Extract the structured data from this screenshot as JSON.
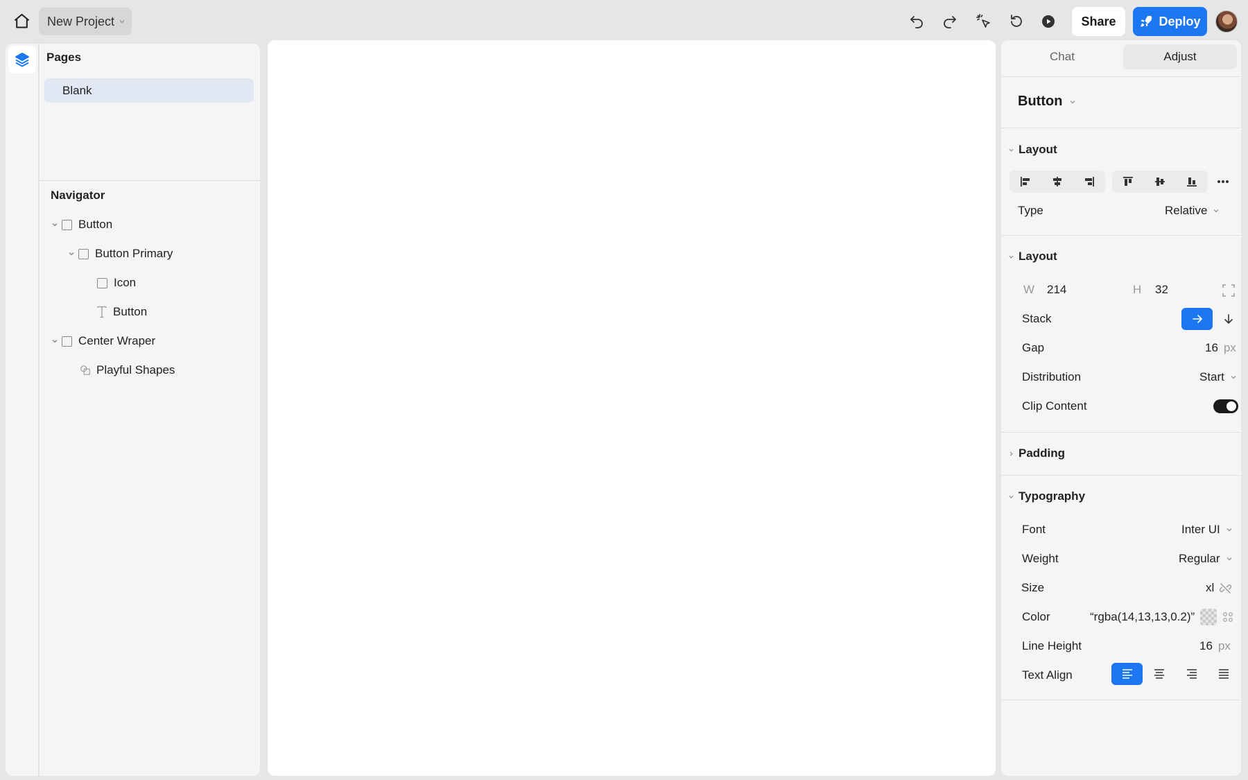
{
  "topbar": {
    "project_name": "New Project",
    "share_label": "Share",
    "deploy_label": "Deploy",
    "icons": [
      "home-icon",
      "undo-icon",
      "redo-icon",
      "cursor-click-icon",
      "refresh-icon",
      "play-icon",
      "rocket-icon"
    ]
  },
  "left": {
    "pages_title": "Pages",
    "pages": [
      {
        "label": "Blank",
        "selected": true
      }
    ],
    "navigator_title": "Navigator",
    "tree": [
      {
        "label": "Button",
        "icon": "frame-icon",
        "expanded": true
      },
      {
        "label": "Button Primary",
        "icon": "frame-icon",
        "expanded": true
      },
      {
        "label": "Icon",
        "icon": "frame-icon"
      },
      {
        "label": "Button",
        "icon": "text-icon"
      },
      {
        "label": "Center Wraper",
        "icon": "frame-icon",
        "expanded": true
      },
      {
        "label": "Playful Shapes",
        "icon": "shapes-icon"
      }
    ]
  },
  "right": {
    "tabs": [
      "Chat",
      "Adjust"
    ],
    "active_tab": "Adjust",
    "component": "Button",
    "layout1": {
      "title": "Layout",
      "type_label": "Type",
      "type_value": "Relative"
    },
    "layout2": {
      "title": "Layout",
      "w_label": "W",
      "w_value": "214",
      "h_label": "H",
      "h_value": "32",
      "stack_label": "Stack",
      "gap_label": "Gap",
      "gap_value": "16",
      "gap_unit": "px",
      "distribution_label": "Distribution",
      "distribution_value": "Start",
      "clip_label": "Clip Content",
      "clip_on": true
    },
    "padding_title": "Padding",
    "typography": {
      "title": "Typography",
      "font_label": "Font",
      "font_value": "Inter UI",
      "weight_label": "Weight",
      "weight_value": "Regular",
      "size_label": "Size",
      "size_value": "xl",
      "color_label": "Color",
      "color_value": "“rgba(14,13,13,0.2)”",
      "lineheight_label": "Line Height",
      "lineheight_value": "16",
      "lineheight_unit": "px",
      "align_label": "Text Align",
      "align_active": "left"
    }
  },
  "colors": {
    "accent": "#1d76f2",
    "selected_page_bg": "#e2e8f3",
    "app_bg": "#e6e6e6",
    "panel_bg": "#f5f5f5"
  }
}
